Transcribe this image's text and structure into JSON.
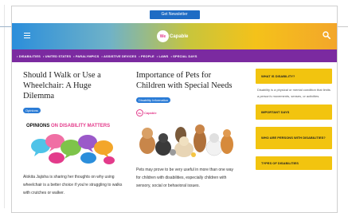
{
  "topbar": {
    "newsletter_label": "Get Newsletter"
  },
  "header": {
    "logo_mark": "We",
    "logo_text": "Capable"
  },
  "nav": {
    "items": [
      "• DISABILITIES",
      "• UNITED STATES",
      "• PARALYMPICS",
      "• ASSISTIVE DEVICES",
      "• PEOPLE",
      "• LAWS",
      "• SPECIAL DAYS"
    ]
  },
  "articles": [
    {
      "title": "Should I Walk or Use a Wheelchair: A Huge Dilemma",
      "tag": "Opinions",
      "banner": {
        "title_black": "OPINIONS ",
        "title_pink": "ON DISABILITY MATTERS"
      },
      "excerpt": "Alokita Jajisha is sharing her thoughts on why using wheelchair is a better choice if you're struggling to walks with crutches or walker."
    },
    {
      "title": "Importance of Pets for Children with Special Needs",
      "tag": "Disability Information",
      "image_logo": {
        "mark": "We",
        "text": "Capable"
      },
      "excerpt": "Pets may prove to be very useful in more than one way for children with disabilities, especially children with sensory, social or behavioral issues."
    }
  ],
  "sidebar": {
    "what_is": "WHAT IS DISABILITY?",
    "description": "Disability is a physical or mental condition that limits a person's movements, senses, or activities.",
    "important_days": "IMPORTANT DAYS",
    "who_are": "WHO ARE PERSONS WITH DISABILITIES?",
    "types": "TYPES OF DISABILITIES"
  },
  "colors": {
    "nav_purple": "#7b2aa0",
    "accent_blue": "#2b7cd6",
    "sidebar_yellow": "#f2c40f",
    "brand_pink": "#e33b8b"
  },
  "icons": [
    "hamburger-menu-icon",
    "search-icon"
  ]
}
